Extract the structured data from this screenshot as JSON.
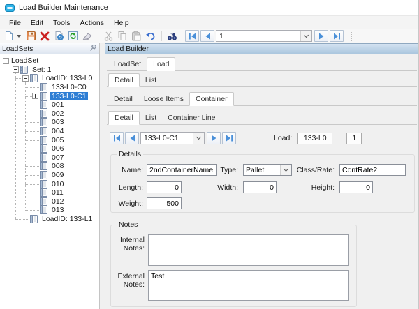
{
  "window": {
    "title": "Load Builder Maintenance",
    "app_icon": "window-app-icon"
  },
  "menu": {
    "items": [
      "File",
      "Edit",
      "Tools",
      "Actions",
      "Help"
    ]
  },
  "toolbar": {
    "icons": [
      "new-document",
      "save",
      "delete",
      "attach",
      "refresh",
      "erase",
      "cut",
      "copy",
      "paste",
      "undo",
      "find"
    ],
    "nav_icons": [
      "first-record",
      "previous-record",
      "next-record",
      "last-record"
    ],
    "record_value": "1"
  },
  "left_panel": {
    "title": "LoadSets",
    "pin_icon": "pushpin-icon",
    "tree": {
      "items": [
        {
          "label": "LoadSet",
          "depth": 0,
          "expander": "minus",
          "icon": false,
          "selected": false
        },
        {
          "label": "Set: 1",
          "depth": 1,
          "expander": "minus",
          "icon": true,
          "selected": false
        },
        {
          "label": "LoadID: 133-L0",
          "depth": 2,
          "expander": "minus",
          "icon": true,
          "selected": false
        },
        {
          "label": "133-L0-C0",
          "depth": 3,
          "expander": "",
          "icon": true,
          "selected": false
        },
        {
          "label": "133-L0-C1",
          "depth": 3,
          "expander": "plus",
          "icon": true,
          "selected": true
        },
        {
          "label": "001",
          "depth": 3,
          "expander": "",
          "icon": true,
          "selected": false
        },
        {
          "label": "002",
          "depth": 3,
          "expander": "",
          "icon": true,
          "selected": false
        },
        {
          "label": "003",
          "depth": 3,
          "expander": "",
          "icon": true,
          "selected": false
        },
        {
          "label": "004",
          "depth": 3,
          "expander": "",
          "icon": true,
          "selected": false
        },
        {
          "label": "005",
          "depth": 3,
          "expander": "",
          "icon": true,
          "selected": false
        },
        {
          "label": "006",
          "depth": 3,
          "expander": "",
          "icon": true,
          "selected": false
        },
        {
          "label": "007",
          "depth": 3,
          "expander": "",
          "icon": true,
          "selected": false
        },
        {
          "label": "008",
          "depth": 3,
          "expander": "",
          "icon": true,
          "selected": false
        },
        {
          "label": "009",
          "depth": 3,
          "expander": "",
          "icon": true,
          "selected": false
        },
        {
          "label": "010",
          "depth": 3,
          "expander": "",
          "icon": true,
          "selected": false
        },
        {
          "label": "011",
          "depth": 3,
          "expander": "",
          "icon": true,
          "selected": false
        },
        {
          "label": "012",
          "depth": 3,
          "expander": "",
          "icon": true,
          "selected": false
        },
        {
          "label": "013",
          "depth": 3,
          "expander": "",
          "icon": true,
          "selected": false
        },
        {
          "label": "LoadID: 133-L1",
          "depth": 2,
          "expander": "",
          "icon": true,
          "selected": false
        }
      ]
    }
  },
  "right_panel": {
    "title": "Load Builder",
    "tabs": {
      "row1": [
        "LoadSet",
        "Load"
      ],
      "row1_active": "Load",
      "row2": [
        "Detail",
        "List"
      ],
      "row2_active": "Detail",
      "row3": [
        "Detail",
        "Loose Items",
        "Container"
      ],
      "row3_active": "Container",
      "row4": [
        "Detail",
        "List",
        "Container Line"
      ],
      "row4_active": "Detail"
    },
    "navigator": {
      "record_value": "133-L0-C1",
      "load_label": "Load:",
      "load_value": "133-L0",
      "load_seq": "1"
    },
    "details": {
      "title": "Details",
      "name_label": "Name:",
      "name_value": "2ndContainerName",
      "type_label": "Type:",
      "type_value": "Pallet",
      "class_rate_label": "Class/Rate:",
      "class_rate_value": "ContRate2",
      "length_label": "Length:",
      "length_value": "0",
      "width_label": "Width:",
      "width_value": "0",
      "height_label": "Height:",
      "height_value": "0",
      "weight_label": "Weight:",
      "weight_value": "500"
    },
    "notes": {
      "title": "Notes",
      "internal_label": "Internal Notes:",
      "internal_value": "",
      "external_label": "External Notes:",
      "external_value": "Test"
    }
  },
  "colors": {
    "selection": "#2e7ed4",
    "header_gradient_top": "#d3e2f1",
    "header_gradient_bottom": "#aac6de",
    "nav_arrow": "#4a90d9",
    "delete_red": "#cc2222"
  }
}
